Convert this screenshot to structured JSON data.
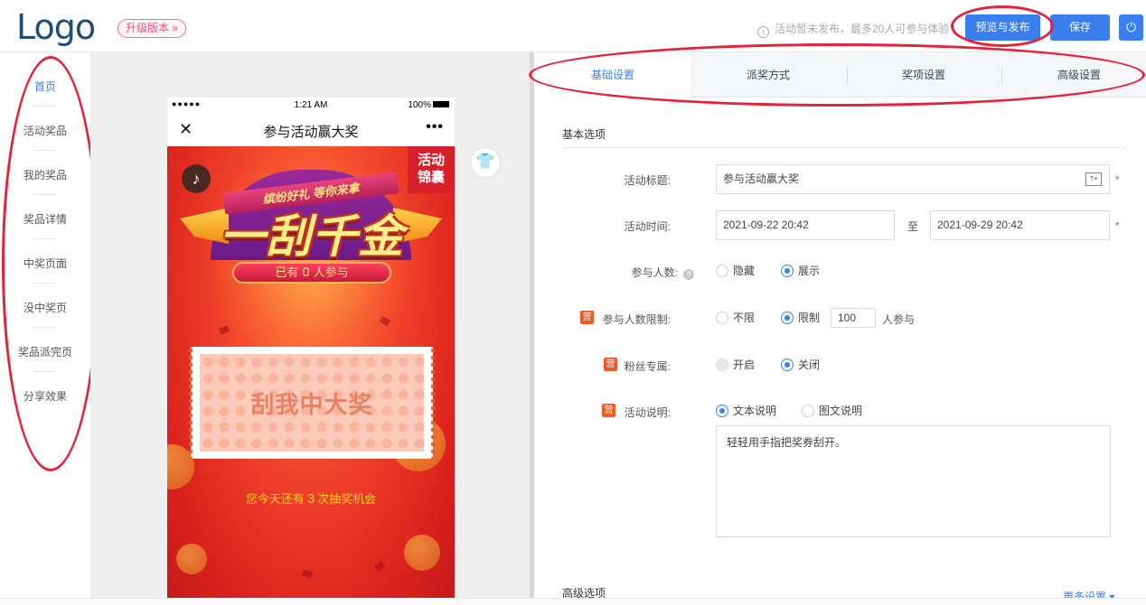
{
  "header": {
    "logo": "Logo",
    "upgrade_label": "升级版本 »",
    "notice": "活动暂未发布，最多20人可参与体验",
    "notice_icon": "info-icon",
    "preview_publish_label": "预览与发布",
    "save_label": "保存",
    "power_icon": "⏻",
    "accent_color": "#3a7ff0"
  },
  "sidebar": {
    "items": [
      {
        "label": "首页",
        "active": true
      },
      {
        "label": "活动奖品"
      },
      {
        "label": "我的奖品"
      },
      {
        "label": "奖品详情"
      },
      {
        "label": "中奖页面"
      },
      {
        "label": "没中奖页"
      },
      {
        "label": "奖品派完页"
      },
      {
        "label": "分享效果"
      }
    ]
  },
  "phone": {
    "status_dots": "●●●●●",
    "status_time": "1:21 AM",
    "status_battery": "100%",
    "close_glyph": "✕",
    "nav_title": "参与活动赢大奖",
    "more_glyph": "•••",
    "tag_line1": "活动",
    "tag_line2": "锦囊",
    "music_glyph": "♪",
    "slogan": "缤纷好礼 等你来拿",
    "big_title": "一刮千金",
    "joined_prefix": "已有",
    "joined_count": "0",
    "joined_suffix": "人参与",
    "scratch_text": "刮我中大奖",
    "chances_prefix": "您今天还有",
    "chances_count": "3",
    "chances_suffix": "次抽奖机会"
  },
  "tabs": [
    {
      "label": "基础设置",
      "active": true
    },
    {
      "label": "派奖方式"
    },
    {
      "label": "奖项设置"
    },
    {
      "label": "高级设置"
    }
  ],
  "form": {
    "section_title": "基本选项",
    "title_label": "活动标题:",
    "title_value": "参与活动赢大奖",
    "time_label": "活动时间:",
    "time_start": "2021-09-22 20:42",
    "time_to": "至",
    "time_end": "2021-09-29 20:42",
    "participants_label": "参与人数:",
    "participants_options": [
      "隐藏",
      "展示"
    ],
    "limit_badge": "营",
    "limit_label": "参与人数限制:",
    "limit_options": [
      "不限",
      "限制"
    ],
    "limit_value": "100",
    "limit_unit": "人参与",
    "fans_badge": "营",
    "fans_label": "粉丝专属:",
    "fans_options": [
      "开启",
      "关闭"
    ],
    "desc_badge": "营",
    "desc_label": "活动说明:",
    "desc_options": [
      "文本说明",
      "图文说明"
    ],
    "desc_text": "轻轻用手指把奖券刮开。",
    "advanced_title": "高级选项",
    "more_settings": "更多设置 ▾",
    "required_mark": "*"
  }
}
